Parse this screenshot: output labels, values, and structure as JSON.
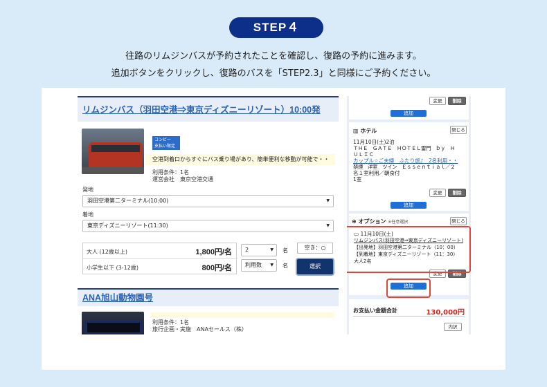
{
  "step": {
    "label": "STEP４"
  },
  "instructions": {
    "line1": "往路のリムジンバスが予約されたことを確認し、復路の予約に進みます。",
    "line2": "追加ボタンをクリックし、復路のバスを「STEP2.3」と同様にご予約ください。"
  },
  "bus1": {
    "title": "リムジンバス（羽田空港⇒東京ディズニーリゾート）10:00発",
    "coupon_line1": "コンビー",
    "coupon_line2": "支払い限定",
    "notice": "空港到着口からすぐにバス乗り場があり、簡単便利な移動が可能で・・",
    "condition": "利用条件：1名",
    "operator": "運営会社　東京空港交通",
    "departure_label": "発地",
    "departure_value": "羽田空港第二ターミナル(10:00)",
    "arrival_label": "着地",
    "arrival_value": "東京ディズニーリゾート(11:30)",
    "fares": [
      {
        "name": "大人 (12歳以上)",
        "price": "1,800円/名",
        "qty": "2",
        "unit": "名"
      },
      {
        "name": "小学生以下 (3-12歳)",
        "price": "800円/名",
        "qty": "利用数",
        "unit": "名"
      }
    ],
    "vacancy": "空き：○",
    "select_button": "選択"
  },
  "bus2": {
    "title": "ANA旭山動物園号",
    "condition": "利用条件：1名",
    "operator": "旅行企画・実施　ANAセールス（株）"
  },
  "sidebar": {
    "change_label": "変更",
    "delete_label": "削除",
    "add_label": "追加",
    "close_label": "閉じる",
    "hotel": {
      "title": "ホテル",
      "line1": "11月10日(土)2泊",
      "line2": "ＴＨＥ　ＧＡＴＥ　ＨＯＴＥＬ雷門　ｂｙ　Ｈ",
      "line3": "ＵＬＩＣ",
      "line4": "カップル☆ご夫婦　ふたり旅♪　2名利用・・",
      "line5": "禁煙　洋室　ツイン　Ｅｓｓｅｎｔｉａｌ／２",
      "line6": "名１室利用／朝食付",
      "line7": "1室"
    },
    "option": {
      "title": "オプション",
      "note": "※任意選択",
      "date": "11月10日(土)",
      "link": "リムジンバス(羽田空港⇒東京ディズニーリゾート)",
      "dep": "【出発地】羽田空港第二ターミナル（10：00）",
      "arr": "【到着地】東京ディズニーリゾート（11：30）",
      "pax": "大人2名"
    },
    "total_label": "お支払い金額合計",
    "total_value": "130,000円",
    "details_label": "内訳"
  }
}
